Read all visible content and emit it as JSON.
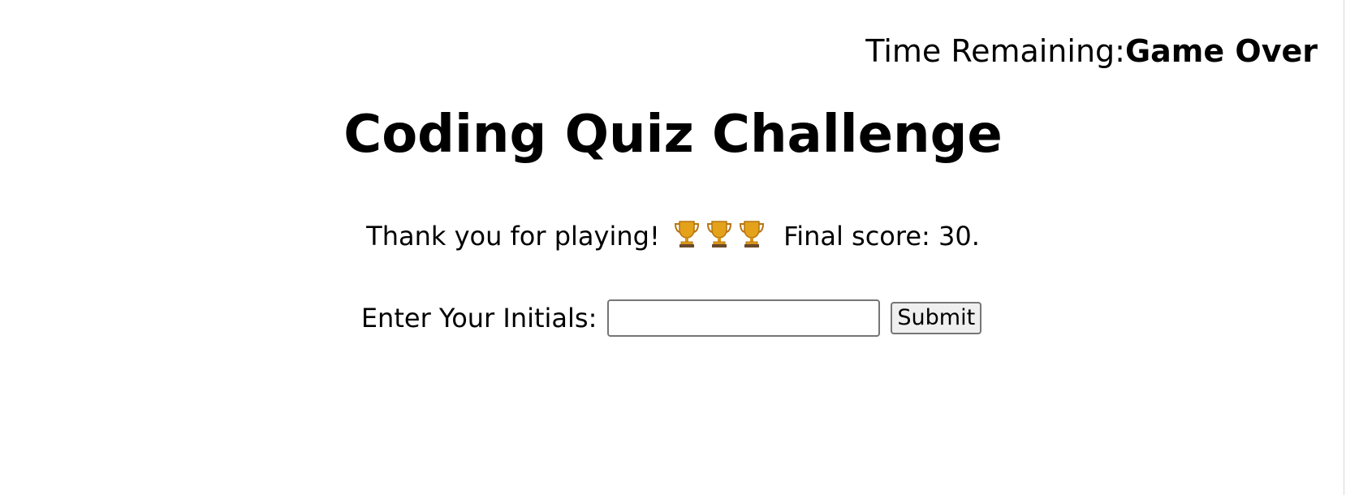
{
  "header": {
    "timer_label": "Time Remaining:",
    "timer_value": "Game Over"
  },
  "main": {
    "title": "Coding Quiz Challenge",
    "thanks_text": "Thank you for playing!",
    "trophy_count": 3,
    "final_score_text": "Final score: 30."
  },
  "form": {
    "initials_label": "Enter Your Initials:",
    "initials_value": "",
    "initials_placeholder": "",
    "submit_label": "Submit"
  },
  "icons": {
    "trophy": "trophy-icon"
  },
  "colors": {
    "trophy_gold": "#E3A21A",
    "trophy_gold_dark": "#B8740F",
    "trophy_base": "#6B4A2B"
  }
}
